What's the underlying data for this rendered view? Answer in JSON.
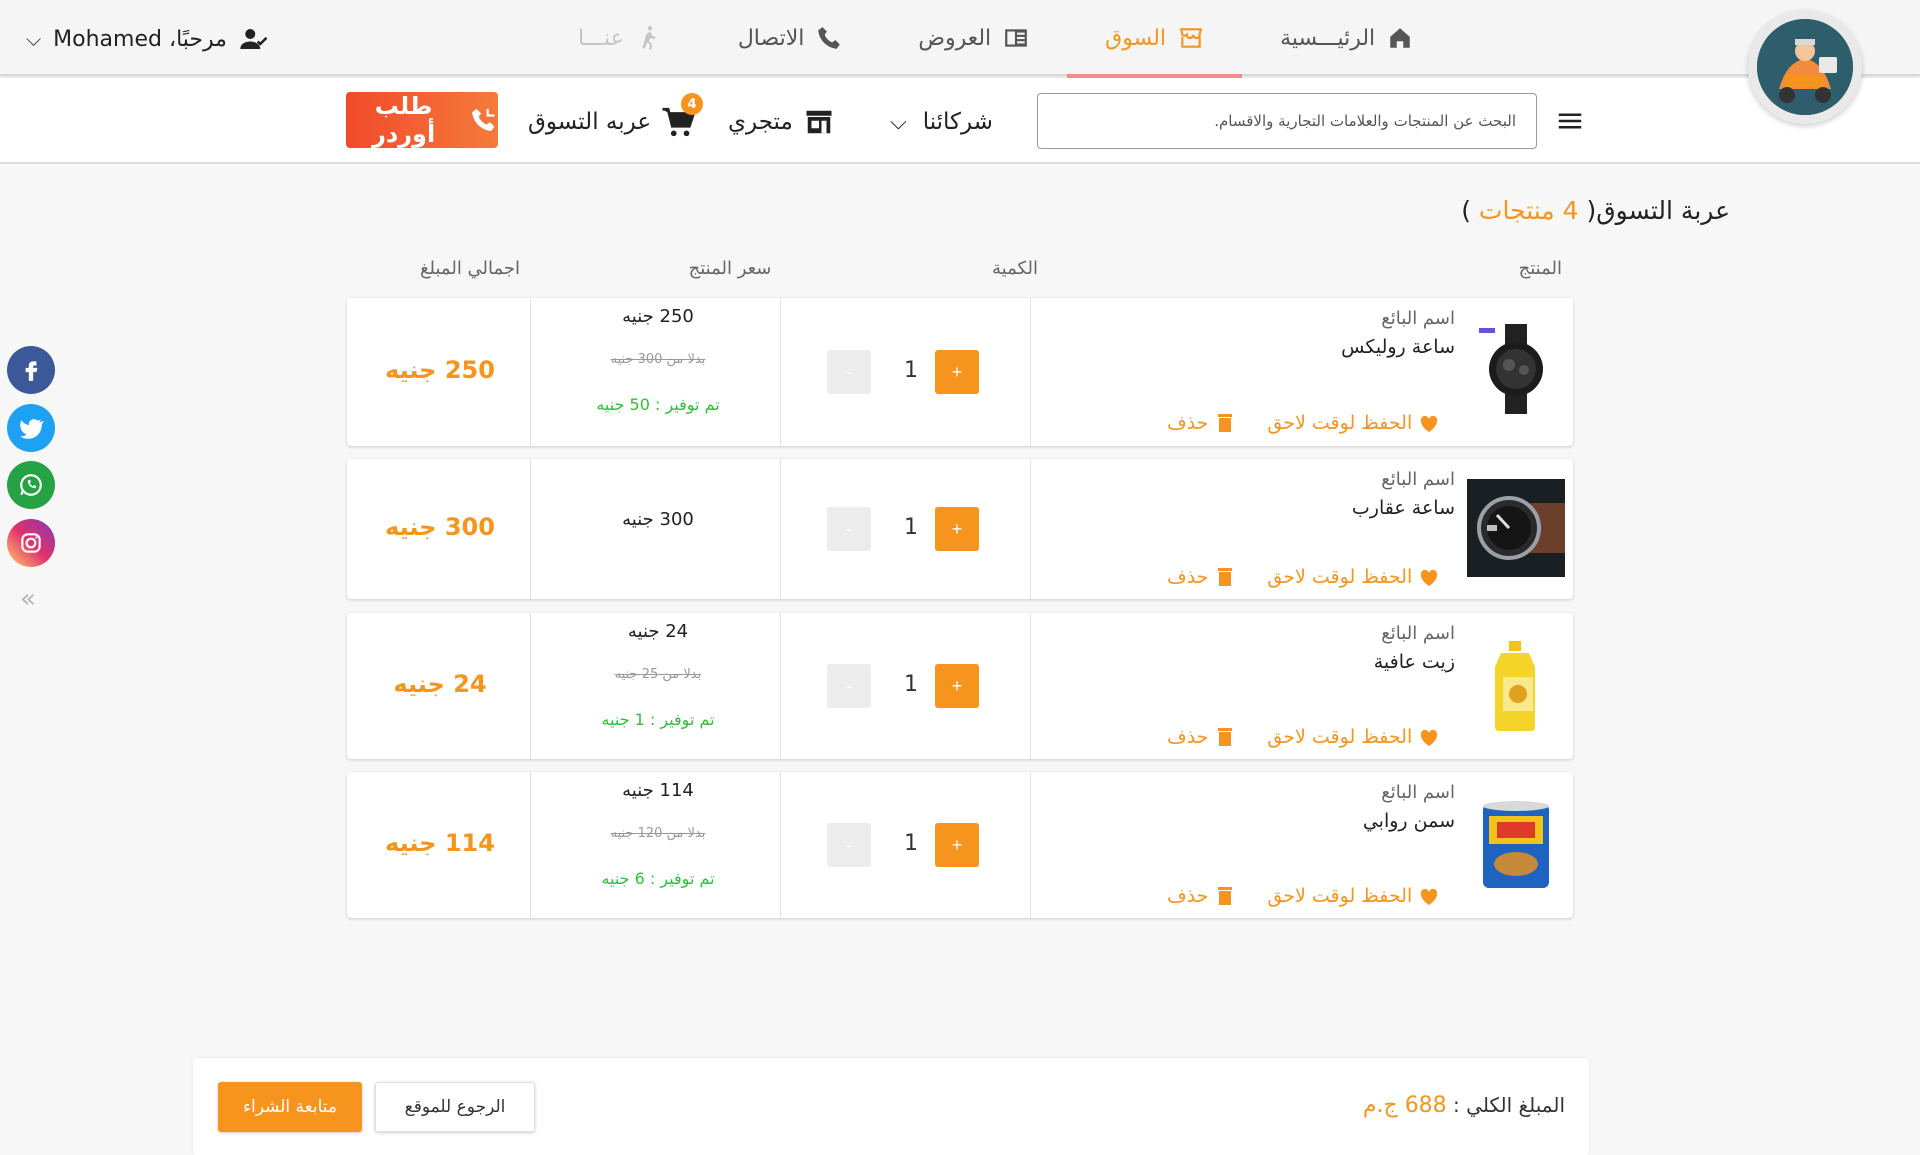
{
  "header": {
    "user_greeting": "مرحبًا، Mohamed",
    "tabs": [
      {
        "label": "الرئيـــسية",
        "icon": "home-icon"
      },
      {
        "label": "السوق",
        "icon": "store-icon",
        "active": true
      },
      {
        "label": "العروض",
        "icon": "offers-icon"
      },
      {
        "label": "الاتصال",
        "icon": "phone-icon"
      },
      {
        "label": "عنـــا",
        "icon": "walking-icon",
        "disabled": true
      }
    ]
  },
  "subbar": {
    "search_placeholder": "البحث عن المنتجات والعلامات التجارية والاقسام.",
    "partners_label": "شركائنا",
    "store_label": "متجري",
    "cart_label": "عربه التسوق",
    "cart_count": "4",
    "order_button": "طلب أوردر"
  },
  "cart": {
    "title_prefix": "عربة التسوق(",
    "title_count": " 4 منتجات",
    "title_suffix": " )",
    "headers": {
      "product": "المنتج",
      "quantity": "الكمية",
      "price": "سعر المنتج",
      "total": "اجمالي المبلغ"
    },
    "save_later_label": "الحفظ لوقت لاحق",
    "delete_label": "حذف",
    "plus_label": "+",
    "minus_label": "-",
    "items": [
      {
        "seller": "اسم البائع",
        "name": "ساعة روليكس",
        "qty": "1",
        "price": "250 جنيه",
        "old_price": "بدلا من 300 جنيه",
        "saving": "تم توفير : 50 جنيه",
        "total": "250 جنيه"
      },
      {
        "seller": "اسم البائع",
        "name": "ساعة عقارب",
        "qty": "1",
        "price": "300 جنيه",
        "old_price": "",
        "saving": "",
        "total": "300 جنيه"
      },
      {
        "seller": "اسم البائع",
        "name": "زيت عافية",
        "qty": "1",
        "price": "24 جنيه",
        "old_price": "بدلا من 25 جنيه",
        "saving": "تم توفير : 1 جنيه",
        "total": "24 جنيه"
      },
      {
        "seller": "اسم البائع",
        "name": "سمن روابي",
        "qty": "1",
        "price": "114 جنيه",
        "old_price": "بدلا من 120 جنيه",
        "saving": "تم توفير : 6 جنيه",
        "total": "114 جنيه"
      }
    ]
  },
  "footer": {
    "total_label": "المبلغ الكلي :",
    "total_amount": "688 ج.م",
    "back_button": "الرجوع للموقع",
    "checkout_button": "متابعة الشراء"
  },
  "colors": {
    "accent": "#f7941d",
    "saving_green": "#2fbf3a",
    "facebook": "#3b5998",
    "twitter": "#1da1f2",
    "whatsapp": "#25a244"
  }
}
